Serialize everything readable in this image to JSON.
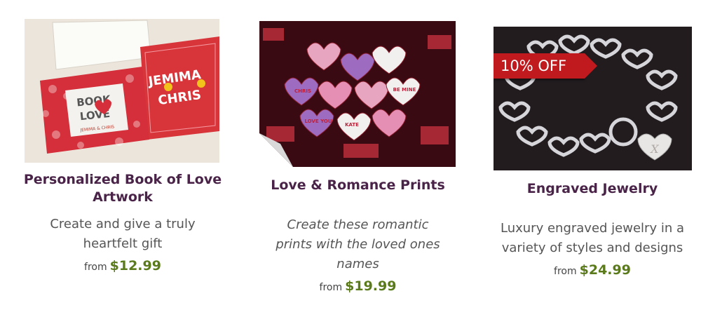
{
  "products": [
    {
      "title": "Personalized Book of Love Artwork",
      "description": "Create and give a truly heartfelt gift",
      "price_prefix": "from",
      "price": "$12.99",
      "image_text": {
        "book_title_1": "BOOK",
        "book_title_2": "LOVE",
        "book_names": "JEMIMA & CHRIS",
        "page_names_1": "JEMIMA",
        "page_names_2": "CHRIS"
      }
    },
    {
      "title": "Love & Romance Prints",
      "description": "Create these romantic prints with the loved ones names",
      "price_prefix": "from",
      "price": "$19.99",
      "image_text": {
        "heart_1": "LOVE YOU",
        "heart_2": "KATE",
        "heart_3": "CHRIS",
        "heart_4": "BE MINE"
      }
    },
    {
      "title": "Engraved Jewelry",
      "description": "Luxury engraved jewelry in a variety of styles and designs",
      "price_prefix": "from",
      "price": "$24.99",
      "badge": "10% OFF",
      "image_text": {
        "engraving": "X"
      }
    }
  ],
  "colors": {
    "title": "#4a2448",
    "price": "#5a7a1c",
    "badge": "#c01a1e"
  }
}
